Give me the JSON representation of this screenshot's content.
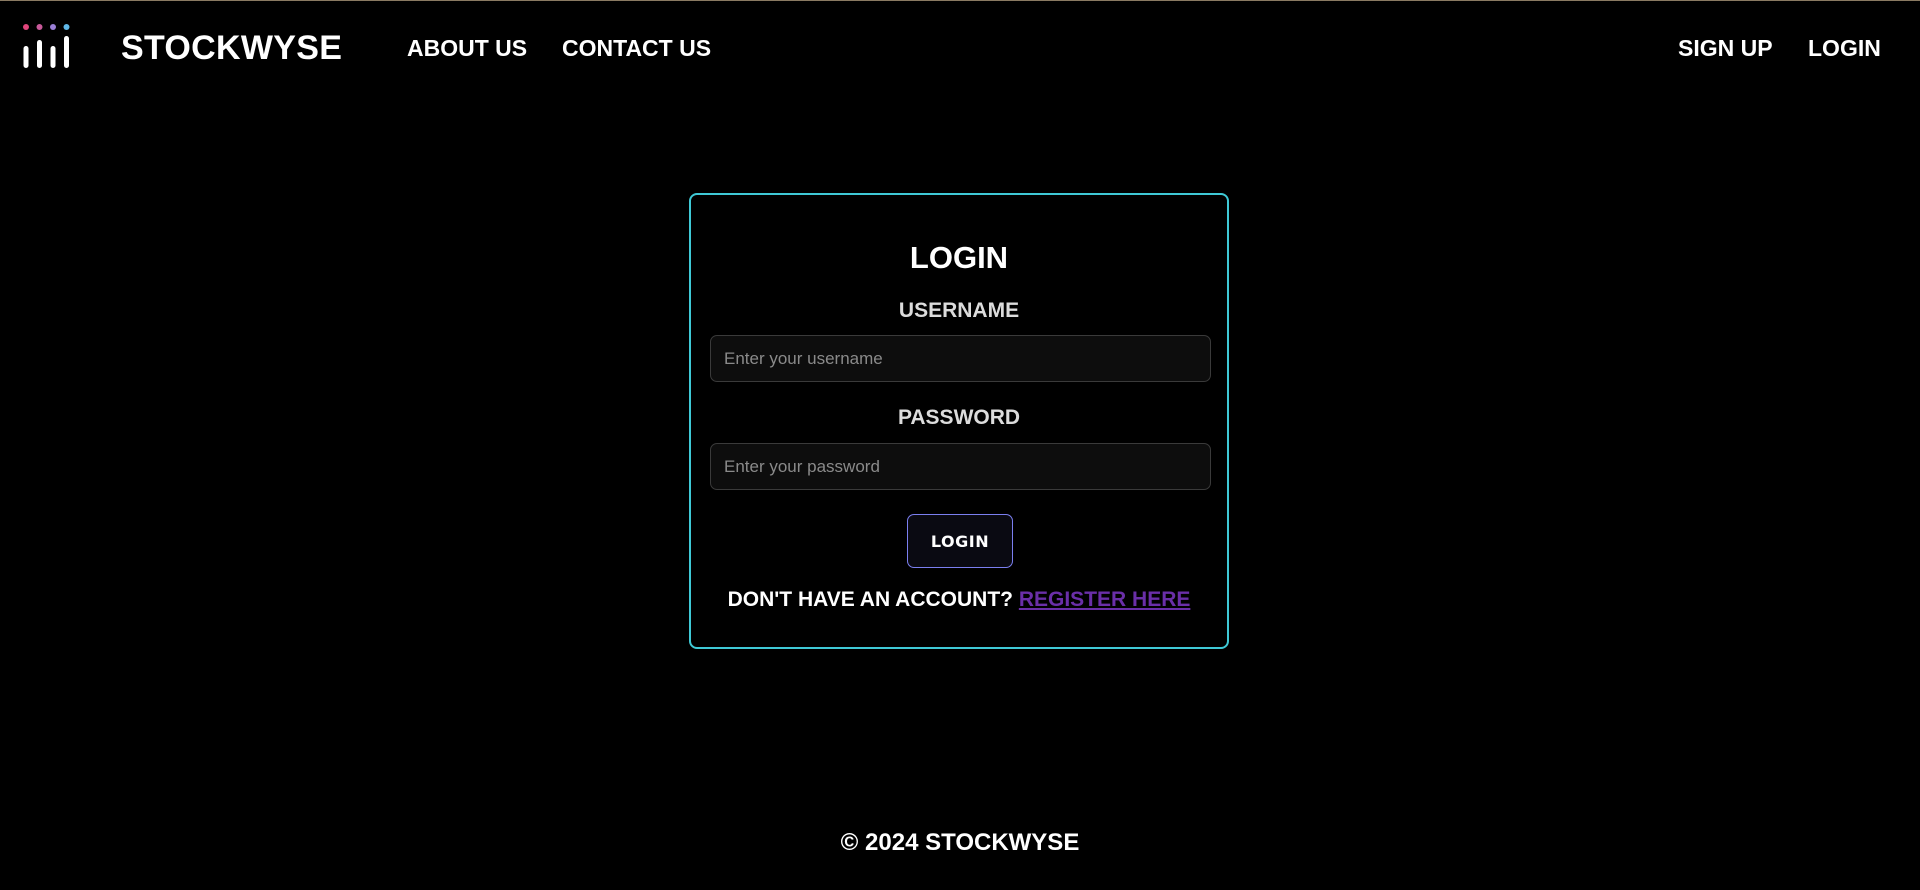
{
  "navbar": {
    "logo_icon": "stockwyse-bars-logo-icon",
    "brand": "STOCKWYSE",
    "links": {
      "about": "ABOUT US",
      "contact": "CONTACT US",
      "signup": "SIGN UP",
      "login": "LOGIN"
    }
  },
  "login_form": {
    "title": "LOGIN",
    "username_label": "USERNAME",
    "username_placeholder": "Enter your username",
    "username_value": "",
    "password_label": "PASSWORD",
    "password_placeholder": "Enter your password",
    "password_value": "",
    "submit_label": "LOGIN",
    "register_prompt": "DON'T HAVE AN ACCOUNT?",
    "register_link": "REGISTER HERE"
  },
  "footer": {
    "copyright": "© 2024 STOCKWYSE"
  },
  "colors": {
    "background": "#000000",
    "card_border": "#3fc9d6",
    "button_border": "#7b7ff0",
    "register_link": "#6a2fa8",
    "logo_dot_1": "#e0457b",
    "logo_dot_2": "#c95a9a",
    "logo_dot_3": "#9a7fd6",
    "logo_dot_4": "#5fb8e8"
  }
}
